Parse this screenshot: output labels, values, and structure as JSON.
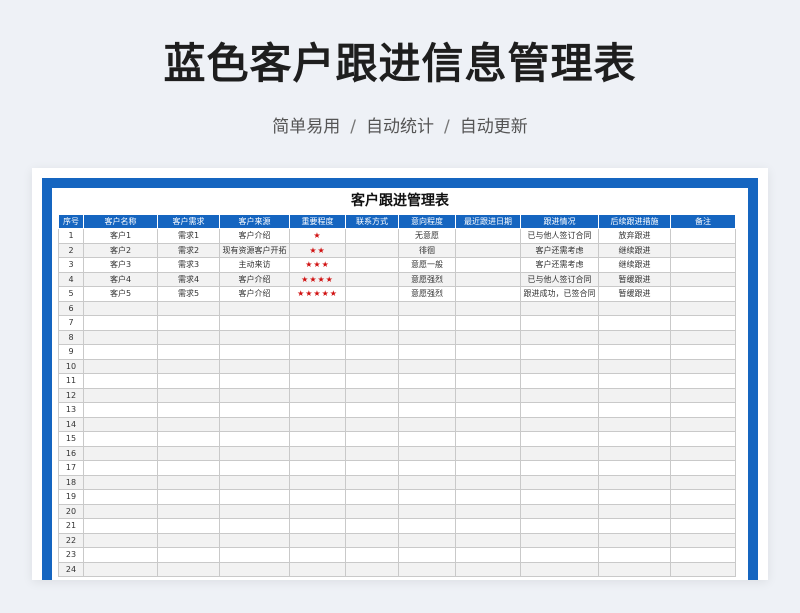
{
  "page": {
    "title": "蓝色客户跟进信息管理表",
    "tagline": [
      "简单易用",
      "自动统计",
      "自动更新"
    ],
    "separator": "/"
  },
  "sheet": {
    "title": "客户跟进管理表",
    "columns": [
      "序号",
      "客户名称",
      "客户需求",
      "客户来源",
      "重要程度",
      "联系方式",
      "意向程度",
      "最近跟进日期",
      "跟进情况",
      "后续跟进措施",
      "备注"
    ],
    "rows": [
      [
        "1",
        "客户1",
        "需求1",
        "客户介绍",
        "★",
        "",
        "无意愿",
        "",
        "已与他人签订合同",
        "放弃跟进",
        ""
      ],
      [
        "2",
        "客户2",
        "需求2",
        "现有资源客户开拓",
        "★★",
        "",
        "徘徊",
        "",
        "客户还需考虑",
        "继续跟进",
        ""
      ],
      [
        "3",
        "客户3",
        "需求3",
        "主动来访",
        "★★★",
        "",
        "意愿一般",
        "",
        "客户还需考虑",
        "继续跟进",
        ""
      ],
      [
        "4",
        "客户4",
        "需求4",
        "客户介绍",
        "★★★★",
        "",
        "意愿强烈",
        "",
        "已与他人签订合同",
        "暂缓跟进",
        ""
      ],
      [
        "5",
        "客户5",
        "需求5",
        "客户介绍",
        "★★★★★",
        "",
        "意愿强烈",
        "",
        "跟进成功，已签合同",
        "暂缓跟进",
        ""
      ],
      [
        "6",
        "",
        "",
        "",
        "",
        "",
        "",
        "",
        "",
        "",
        ""
      ],
      [
        "7",
        "",
        "",
        "",
        "",
        "",
        "",
        "",
        "",
        "",
        ""
      ],
      [
        "8",
        "",
        "",
        "",
        "",
        "",
        "",
        "",
        "",
        "",
        ""
      ],
      [
        "9",
        "",
        "",
        "",
        "",
        "",
        "",
        "",
        "",
        "",
        ""
      ],
      [
        "10",
        "",
        "",
        "",
        "",
        "",
        "",
        "",
        "",
        "",
        ""
      ],
      [
        "11",
        "",
        "",
        "",
        "",
        "",
        "",
        "",
        "",
        "",
        ""
      ],
      [
        "12",
        "",
        "",
        "",
        "",
        "",
        "",
        "",
        "",
        "",
        ""
      ],
      [
        "13",
        "",
        "",
        "",
        "",
        "",
        "",
        "",
        "",
        "",
        ""
      ],
      [
        "14",
        "",
        "",
        "",
        "",
        "",
        "",
        "",
        "",
        "",
        ""
      ],
      [
        "15",
        "",
        "",
        "",
        "",
        "",
        "",
        "",
        "",
        "",
        ""
      ],
      [
        "16",
        "",
        "",
        "",
        "",
        "",
        "",
        "",
        "",
        "",
        ""
      ],
      [
        "17",
        "",
        "",
        "",
        "",
        "",
        "",
        "",
        "",
        "",
        ""
      ],
      [
        "18",
        "",
        "",
        "",
        "",
        "",
        "",
        "",
        "",
        "",
        ""
      ],
      [
        "19",
        "",
        "",
        "",
        "",
        "",
        "",
        "",
        "",
        "",
        ""
      ],
      [
        "20",
        "",
        "",
        "",
        "",
        "",
        "",
        "",
        "",
        "",
        ""
      ],
      [
        "21",
        "",
        "",
        "",
        "",
        "",
        "",
        "",
        "",
        "",
        ""
      ],
      [
        "22",
        "",
        "",
        "",
        "",
        "",
        "",
        "",
        "",
        "",
        ""
      ],
      [
        "23",
        "",
        "",
        "",
        "",
        "",
        "",
        "",
        "",
        "",
        ""
      ],
      [
        "24",
        "",
        "",
        "",
        "",
        "",
        "",
        "",
        "",
        "",
        ""
      ]
    ]
  },
  "colors": {
    "accent": "#1565c0",
    "star": "#d01010",
    "stripe": "#f2f2f2"
  }
}
